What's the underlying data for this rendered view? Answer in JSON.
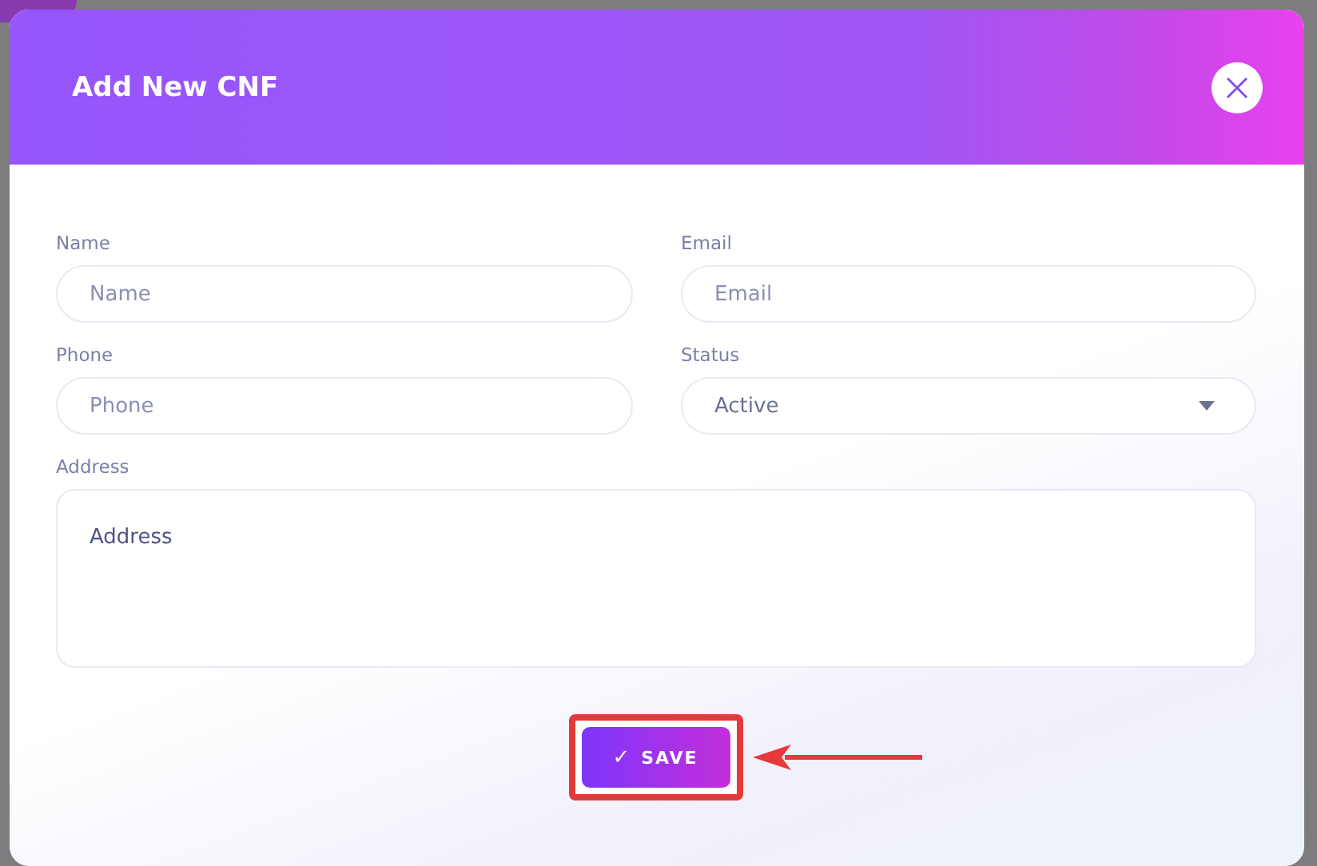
{
  "dialog": {
    "title": "Add New CNF",
    "fields": [
      {
        "kind": "text",
        "label": "Name",
        "placeholder": "Name"
      },
      {
        "kind": "text",
        "label": "Email",
        "placeholder": "Email"
      },
      {
        "kind": "text",
        "label": "Phone",
        "placeholder": "Phone"
      },
      {
        "kind": "select",
        "label": "Status",
        "value": "Active"
      },
      {
        "kind": "textarea",
        "label": "Address",
        "placeholder": "Address"
      }
    ],
    "save_button": {
      "icon": "✓",
      "label": "SAVE"
    }
  }
}
